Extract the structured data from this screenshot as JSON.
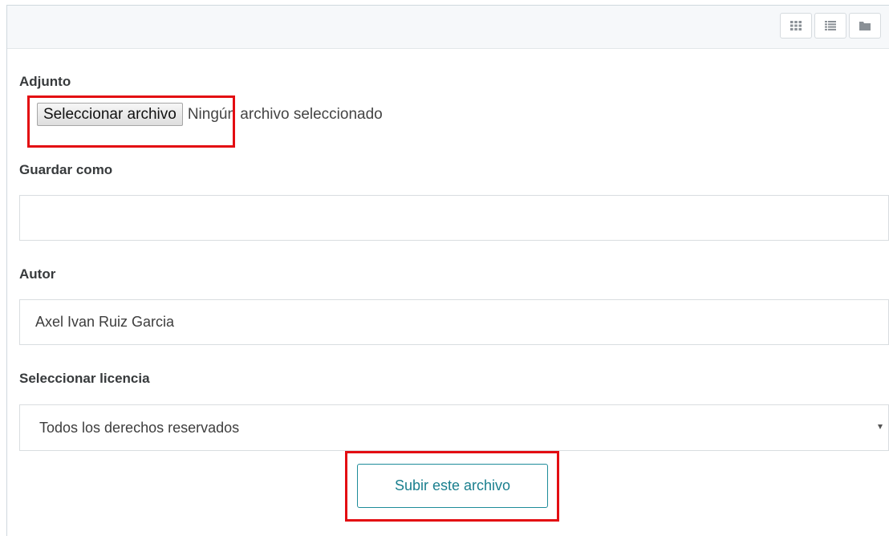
{
  "toolbar": {
    "view_buttons": [
      {
        "icon": "grid-icon"
      },
      {
        "icon": "list-icon"
      },
      {
        "icon": "folder-icon"
      }
    ]
  },
  "form": {
    "attachment": {
      "label": "Adjunto",
      "button_label": "Seleccionar archivo",
      "status": "Ningún archivo seleccionado"
    },
    "save_as": {
      "label": "Guardar como",
      "value": ""
    },
    "author": {
      "label": "Autor",
      "value": "Axel Ivan Ruiz Garcia"
    },
    "license": {
      "label": "Seleccionar licencia",
      "selected": "Todos los derechos reservados"
    },
    "submit_label": "Subir este archivo"
  },
  "colors": {
    "highlight": "#e30d12",
    "accent": "#1e8c9a"
  }
}
